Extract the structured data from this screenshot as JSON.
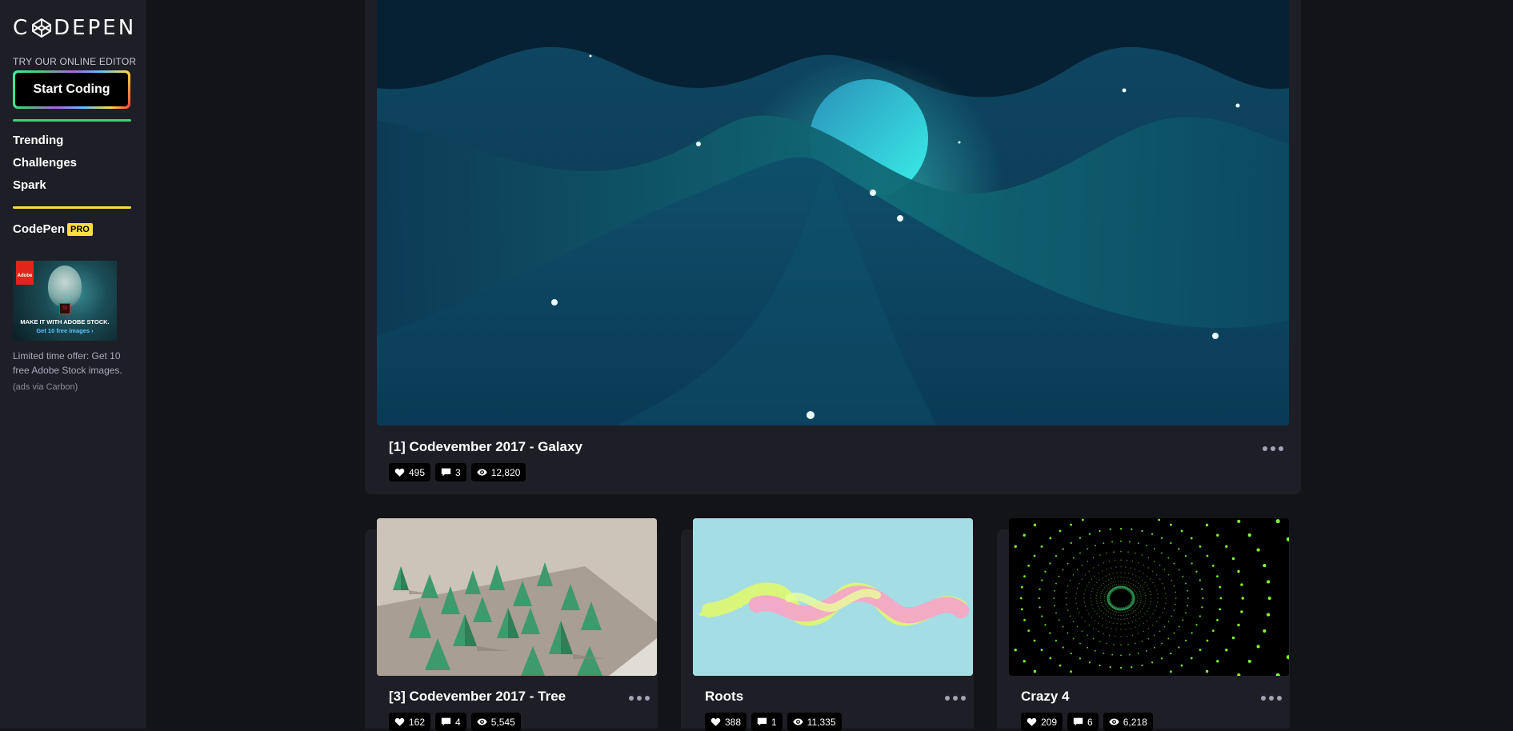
{
  "brand": {
    "logo_text": "CODEPEN"
  },
  "sidebar": {
    "try_label": "TRY OUR ONLINE EDITOR",
    "start_button": "Start Coding",
    "nav": [
      {
        "label": "Trending"
      },
      {
        "label": "Challenges"
      },
      {
        "label": "Spark"
      }
    ],
    "pro": {
      "name": "CodePen",
      "badge": "PRO"
    },
    "ad": {
      "image_line1": "MAKE IT WITH ADOBE STOCK.",
      "image_line2": "Get 10 free images ›",
      "adobe_tag": "Adobe",
      "st_badge": "St",
      "text": "Limited time offer: Get 10 free Adobe Stock images.",
      "via": "(ads via Carbon)"
    }
  },
  "featured": {
    "title": "[1] Codevember 2017 - Galaxy",
    "likes": "495",
    "comments": "3",
    "views": "12,820"
  },
  "pens": [
    {
      "title": "[3] Codevember 2017 - Tree",
      "likes": "162",
      "comments": "4",
      "views": "5,545",
      "thumb": "low-poly-forest"
    },
    {
      "title": "Roots",
      "likes": "388",
      "comments": "1",
      "views": "11,335",
      "thumb": "twisted-helix"
    },
    {
      "title": "Crazy 4",
      "likes": "209",
      "comments": "6",
      "views": "6,218",
      "thumb": "green-dot-tunnel"
    }
  ],
  "icons": {
    "like": "heart-icon",
    "comment": "comment-icon",
    "view": "eye-icon",
    "more": "more-dots-icon"
  },
  "colors": {
    "page_bg": "#131417",
    "panel_bg": "#1e1f26",
    "green": "#47cf73",
    "yellow": "#ffdd40",
    "badge_bg": "#000000"
  }
}
